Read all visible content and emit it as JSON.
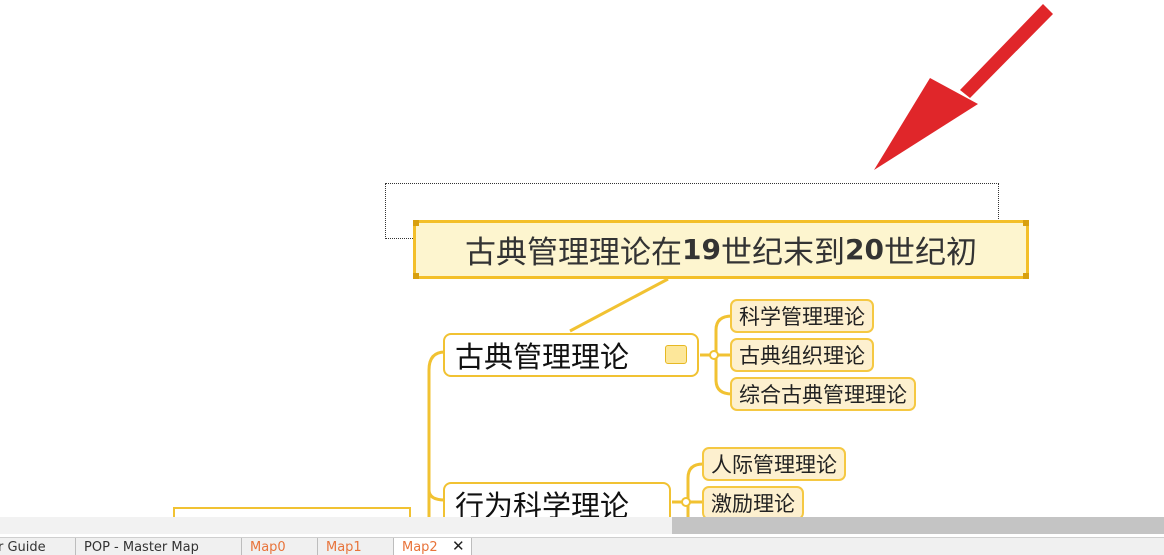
{
  "callout": {
    "segments": [
      {
        "text": "古典管理理论在",
        "bold": false
      },
      {
        "text": "19",
        "bold": true
      },
      {
        "text": "世纪末到",
        "bold": false
      },
      {
        "text": "20",
        "bold": true
      },
      {
        "text": "世纪初",
        "bold": false
      }
    ]
  },
  "topics": {
    "classical": {
      "label": "古典管理理论",
      "subtopics": [
        "科学管理理论",
        "古典组织理论",
        "综合古典管理理论"
      ]
    },
    "behavioral": {
      "label": "行为科学理论",
      "subtopics": [
        "人际管理理论",
        "激励理论"
      ]
    }
  },
  "tabs": [
    {
      "label": "r Guide",
      "type": "doc"
    },
    {
      "label": "POP - Master Map",
      "type": "doc"
    },
    {
      "label": "Map0",
      "type": "map"
    },
    {
      "label": "Map1",
      "type": "map"
    },
    {
      "label": "Map2",
      "type": "map",
      "active": true
    }
  ],
  "tab_close_glyph": "✕",
  "colors": {
    "branch": "#f1c232",
    "callout_fill": "#fdf5cf",
    "subtopic_fill": "#fdf0cf",
    "arrow": "#e0262a",
    "map_tab_text": "#e8743b"
  }
}
